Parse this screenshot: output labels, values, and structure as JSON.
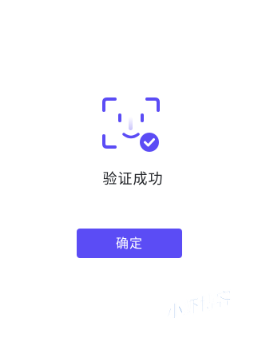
{
  "verification": {
    "status_text": "验证成功",
    "confirm_label": "确定"
  },
  "watermark": {
    "text": "小虾博客"
  },
  "colors": {
    "accent": "#5b4cf5",
    "text": "#222428",
    "watermark": "#3a7bd5"
  },
  "icons": {
    "face": "face-scan-icon",
    "check": "check-badge-icon"
  }
}
